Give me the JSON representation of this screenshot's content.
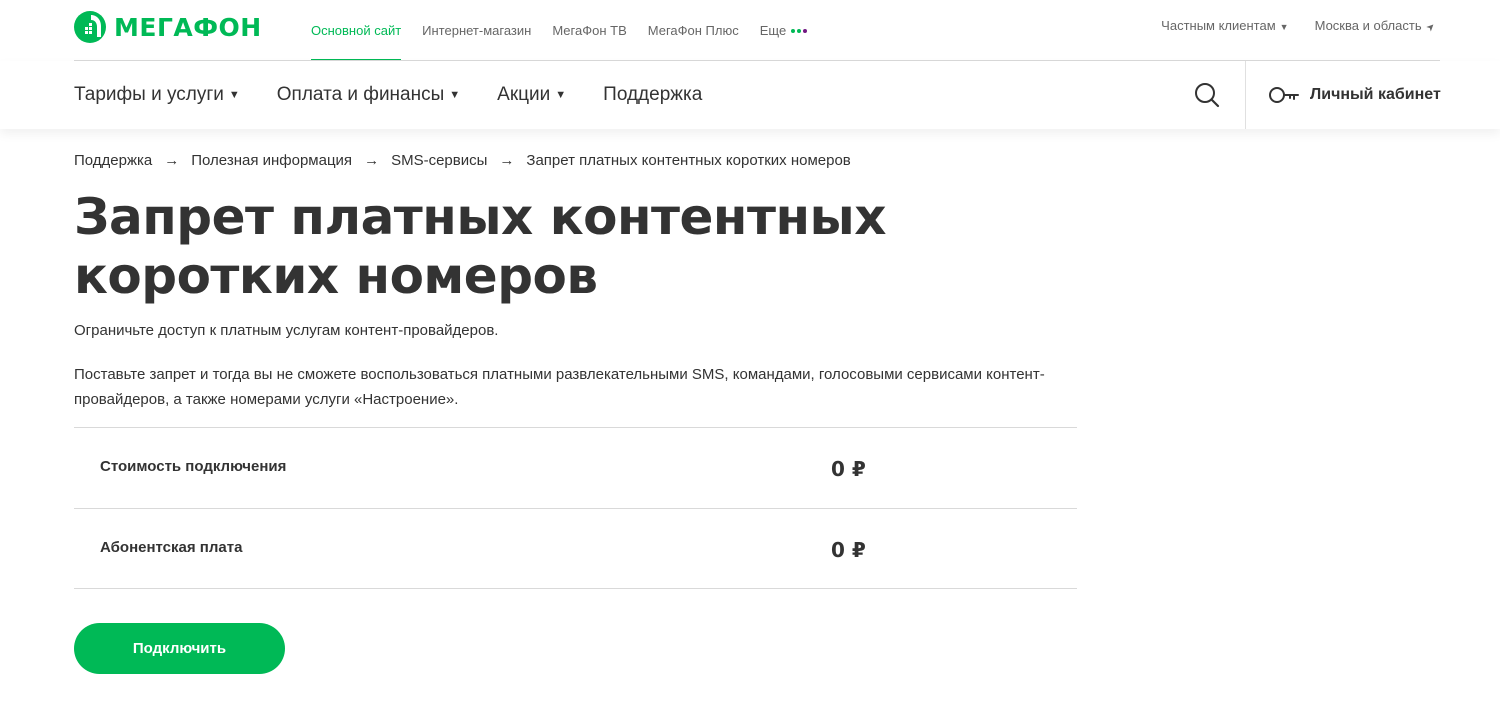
{
  "colors": {
    "brand": "#00b956",
    "brand_dot_purple": "#731982",
    "text": "#333333"
  },
  "header": {
    "logo_text": "МЕГАФОН",
    "top_links": [
      {
        "label": "Основной сайт",
        "active": true
      },
      {
        "label": "Интернет-магазин"
      },
      {
        "label": "МегаФон ТВ"
      },
      {
        "label": "МегаФон Плюс"
      },
      {
        "label": "Еще"
      }
    ],
    "segment": "Частным клиентам",
    "region": "Москва и область"
  },
  "nav": {
    "items": [
      {
        "label": "Тарифы и услуги",
        "dropdown": true
      },
      {
        "label": "Оплата и финансы",
        "dropdown": true
      },
      {
        "label": "Акции",
        "dropdown": true
      },
      {
        "label": "Поддержка",
        "dropdown": false
      }
    ],
    "search_icon": "search-icon",
    "cabinet_icon": "key-icon",
    "cabinet_label": "Личный кабинет"
  },
  "breadcrumb": {
    "separator": "→",
    "items": [
      "Поддержка",
      "Полезная информация",
      "SMS-сервисы",
      "Запрет платных контентных коротких номеров"
    ]
  },
  "page": {
    "title_line1": "Запрет платных контентных",
    "title_line2": "коротких номеров",
    "lead": "Ограничьте доступ к платным услугам контент-провайдеров.",
    "description": "Поставьте запрет и тогда вы не сможете воспользоваться платными развлекательными SMS, командами, голосовыми сервисами контент-провайдеров, а также номерами услуги «Настроение»."
  },
  "prices": [
    {
      "label": "Стоимость подключения",
      "value": "0 ₽"
    },
    {
      "label": "Абонентская плата",
      "value": "0 ₽"
    }
  ],
  "actions": {
    "connect_label": "Подключить"
  }
}
